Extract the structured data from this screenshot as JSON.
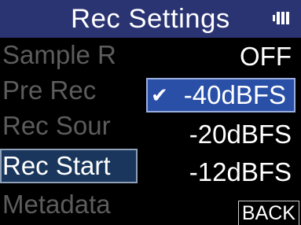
{
  "header": {
    "title": "Rec Settings",
    "battery_icon": "battery-full-icon"
  },
  "menu": {
    "items": [
      {
        "label": "Sample R",
        "selected": false
      },
      {
        "label": "Pre Rec",
        "selected": false
      },
      {
        "label": "Rec Sour",
        "selected": false
      },
      {
        "label": "Rec Start",
        "selected": true
      },
      {
        "label": "Metadata",
        "selected": false
      }
    ]
  },
  "options": {
    "items": [
      {
        "label": "OFF",
        "selected": false
      },
      {
        "label": "-40dBFS",
        "selected": true
      },
      {
        "label": "-20dBFS",
        "selected": false
      },
      {
        "label": "-12dBFS",
        "selected": false
      }
    ],
    "check_glyph": "✔",
    "back_label": "BACK"
  },
  "colors": {
    "title_bar": "#2a3473",
    "selected_menu": "#1a365c",
    "selected_option": "#2a4fa6",
    "dim_text": "#5c5c5c"
  }
}
